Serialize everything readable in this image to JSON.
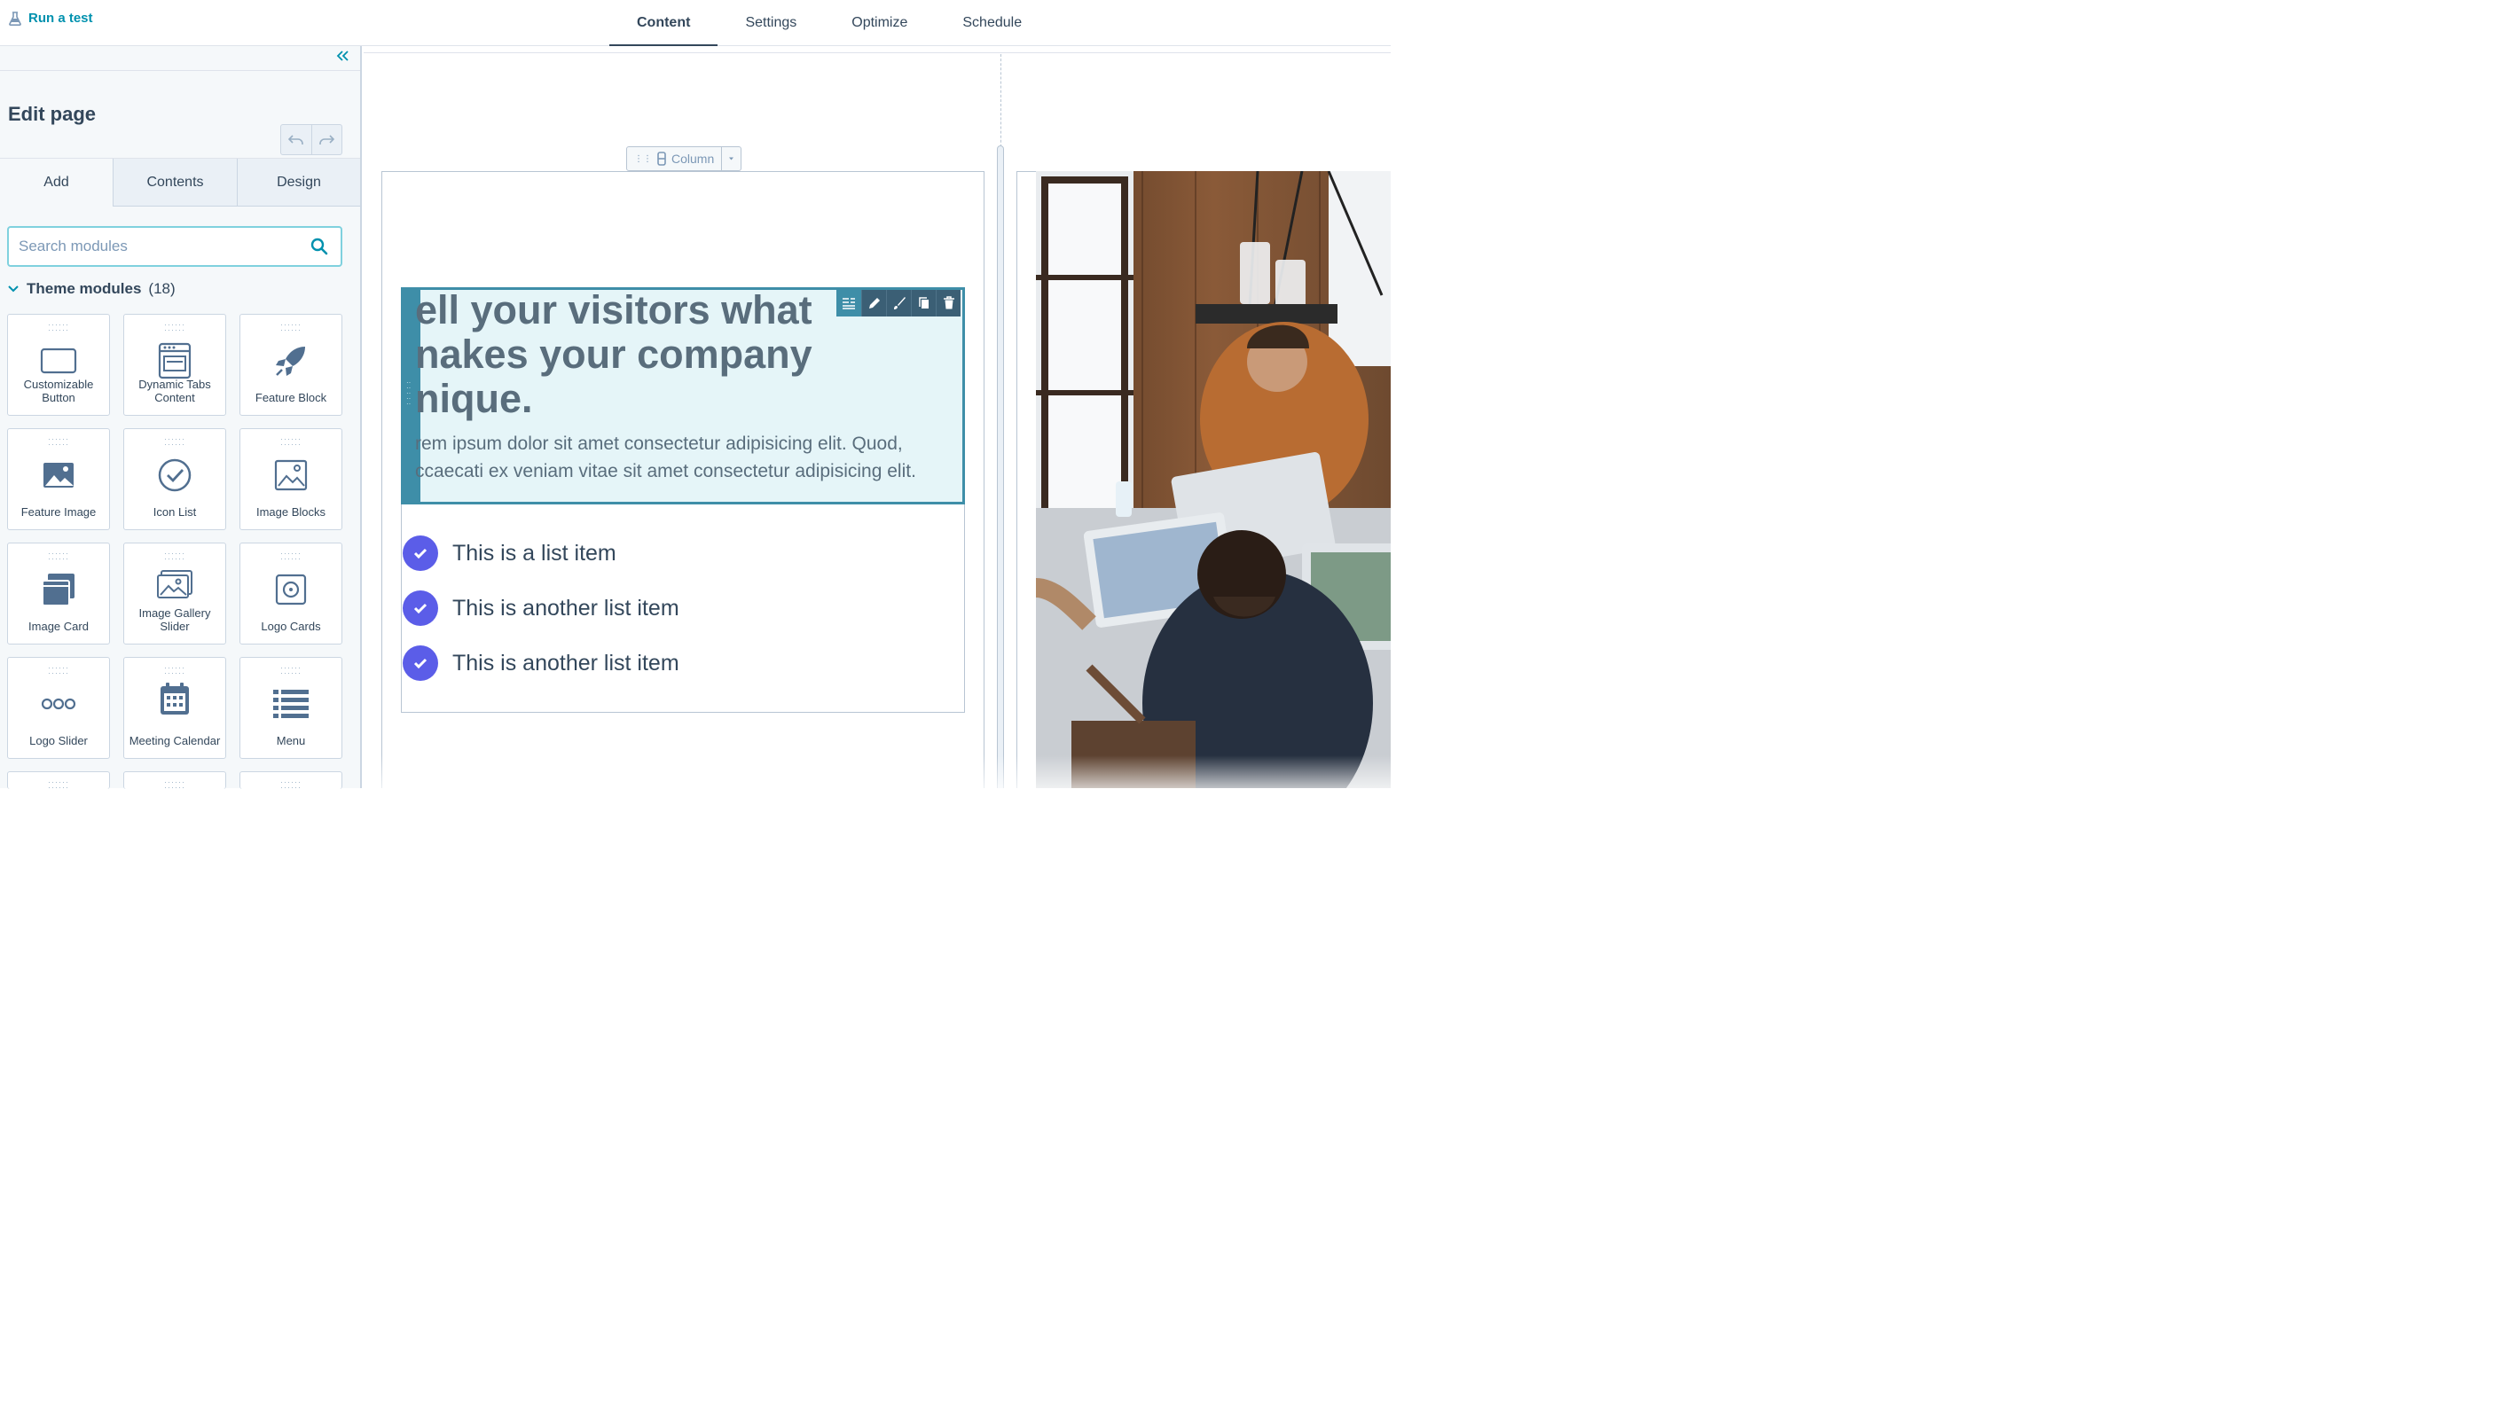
{
  "topbar": {
    "run_test_label": "Run a test",
    "tabs": [
      {
        "label": "Content",
        "active": true
      },
      {
        "label": "Settings",
        "active": false
      },
      {
        "label": "Optimize",
        "active": false
      },
      {
        "label": "Schedule",
        "active": false
      }
    ]
  },
  "sidebar": {
    "title": "Edit page",
    "tabs": [
      {
        "label": "Add",
        "active": true
      },
      {
        "label": "Contents",
        "active": false
      },
      {
        "label": "Design",
        "active": false
      }
    ],
    "search": {
      "placeholder": "Search modules",
      "value": ""
    },
    "theme_modules": {
      "label": "Theme modules",
      "count": "(18)"
    },
    "modules": [
      {
        "label": "Customizable Button",
        "icon": "button-icon"
      },
      {
        "label": "Dynamic Tabs Content",
        "icon": "tabs-content-icon"
      },
      {
        "label": "Feature Block",
        "icon": "rocket-icon"
      },
      {
        "label": "Feature Image",
        "icon": "image-icon"
      },
      {
        "label": "Icon List",
        "icon": "check-circle-icon"
      },
      {
        "label": "Image Blocks",
        "icon": "image-blocks-icon"
      },
      {
        "label": "Image Card",
        "icon": "image-card-icon"
      },
      {
        "label": "Image Gallery Slider",
        "icon": "gallery-icon"
      },
      {
        "label": "Logo Cards",
        "icon": "logo-card-icon"
      },
      {
        "label": "Logo Slider",
        "icon": "dots-icon"
      },
      {
        "label": "Meeting Calendar",
        "icon": "calendar-icon"
      },
      {
        "label": "Menu",
        "icon": "menu-list-icon"
      }
    ]
  },
  "canvas": {
    "column_label": "Column",
    "heading": "ell your visitors what\nnakes your company\nnique.",
    "body": "rem ipsum dolor sit amet consectetur adipisicing elit. Quod,\nccaecati ex veniam vitae sit amet consectetur adipisicing elit.",
    "list_items": [
      "This is a list item",
      "This is another list item",
      "This is another list item"
    ]
  },
  "colors": {
    "accent": "#0091ae",
    "selection": "#3e8ea8",
    "check": "#5b5de8",
    "text": "#33475b"
  }
}
